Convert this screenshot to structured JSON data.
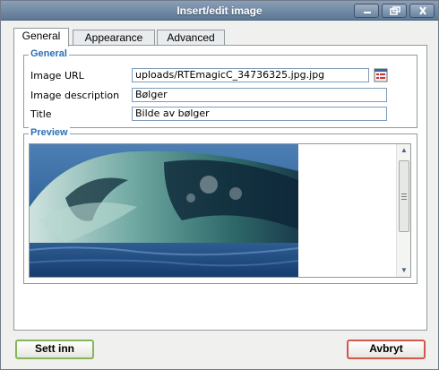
{
  "window": {
    "title": "Insert/edit image",
    "controls": [
      "minimize-icon",
      "maximize-icon",
      "close-icon"
    ]
  },
  "tabs": [
    {
      "label": "General",
      "active": true
    },
    {
      "label": "Appearance",
      "active": false
    },
    {
      "label": "Advanced",
      "active": false
    }
  ],
  "general": {
    "legend": "General",
    "image_url_label": "Image URL",
    "image_url_value": "uploads/RTEmagicC_34736325.jpg.jpg",
    "description_label": "Image description",
    "description_value": "Bølger",
    "title_label": "Title",
    "title_value": "Bilde av bølger",
    "browse_icon": "browse-icon"
  },
  "preview": {
    "legend": "Preview"
  },
  "footer": {
    "insert_label": "Sett inn",
    "cancel_label": "Avbryt"
  },
  "colors": {
    "accent": "#2b6fb6",
    "titlebar": "#5d7795",
    "insert_border": "#86b55a",
    "cancel_border": "#d0574b"
  }
}
